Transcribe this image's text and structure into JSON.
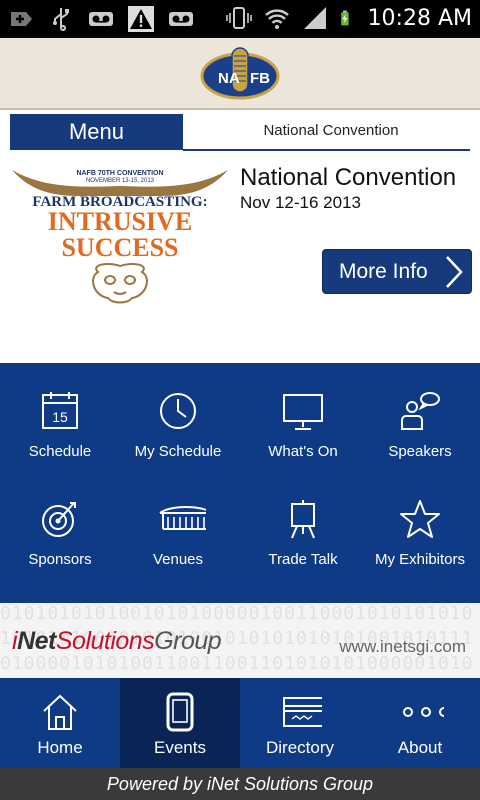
{
  "status_bar": {
    "time": "10:28 AM",
    "icons": [
      "add-icon",
      "usb-icon",
      "voicemail-icon",
      "warning-icon",
      "voicemail-icon",
      "vibrate-icon",
      "wifi-icon",
      "signal-icon",
      "battery-charging-icon"
    ]
  },
  "header": {
    "logo_name": "nafb-logo"
  },
  "menu": {
    "button_label": "Menu",
    "page_heading": "National Convention"
  },
  "event": {
    "title": "National Convention",
    "dates": "Nov 12-16 2013",
    "more_info_label": "More Info",
    "poster": {
      "line1": "NAFB 70TH CONVENTION",
      "line2": "NOVEMBER 13-15, 2013",
      "line3": "FARM BROADCASTING:",
      "line4": "INTRUSIVE",
      "line5": "SUCCESS"
    }
  },
  "grid": {
    "items": [
      {
        "label": "Schedule",
        "icon": "calendar-icon",
        "day": "15"
      },
      {
        "label": "My Schedule",
        "icon": "clock-icon"
      },
      {
        "label": "What's On",
        "icon": "monitor-icon"
      },
      {
        "label": "Speakers",
        "icon": "speakers-icon"
      },
      {
        "label": "Sponsors",
        "icon": "target-icon"
      },
      {
        "label": "Venues",
        "icon": "stadium-icon"
      },
      {
        "label": "Trade Talk",
        "icon": "easel-icon"
      },
      {
        "label": "My Exhibitors",
        "icon": "star-icon"
      }
    ]
  },
  "banner": {
    "brand_i": "i",
    "brand_net": "Net",
    "brand_solutions": "Solutions",
    "brand_group": "Group",
    "url": "www.inetsgi.com"
  },
  "tabs": [
    {
      "label": "Home",
      "icon": "home-icon",
      "active": false
    },
    {
      "label": "Events",
      "icon": "phone-icon",
      "active": true
    },
    {
      "label": "Directory",
      "icon": "card-icon",
      "active": false
    },
    {
      "label": "About",
      "icon": "more-icon",
      "active": false
    }
  ],
  "footer": {
    "text": "Powered by iNet Solutions Group"
  },
  "colors": {
    "brand_blue": "#0f3a86",
    "active_tab": "#0a2456",
    "header_bg": "#ece6da"
  }
}
